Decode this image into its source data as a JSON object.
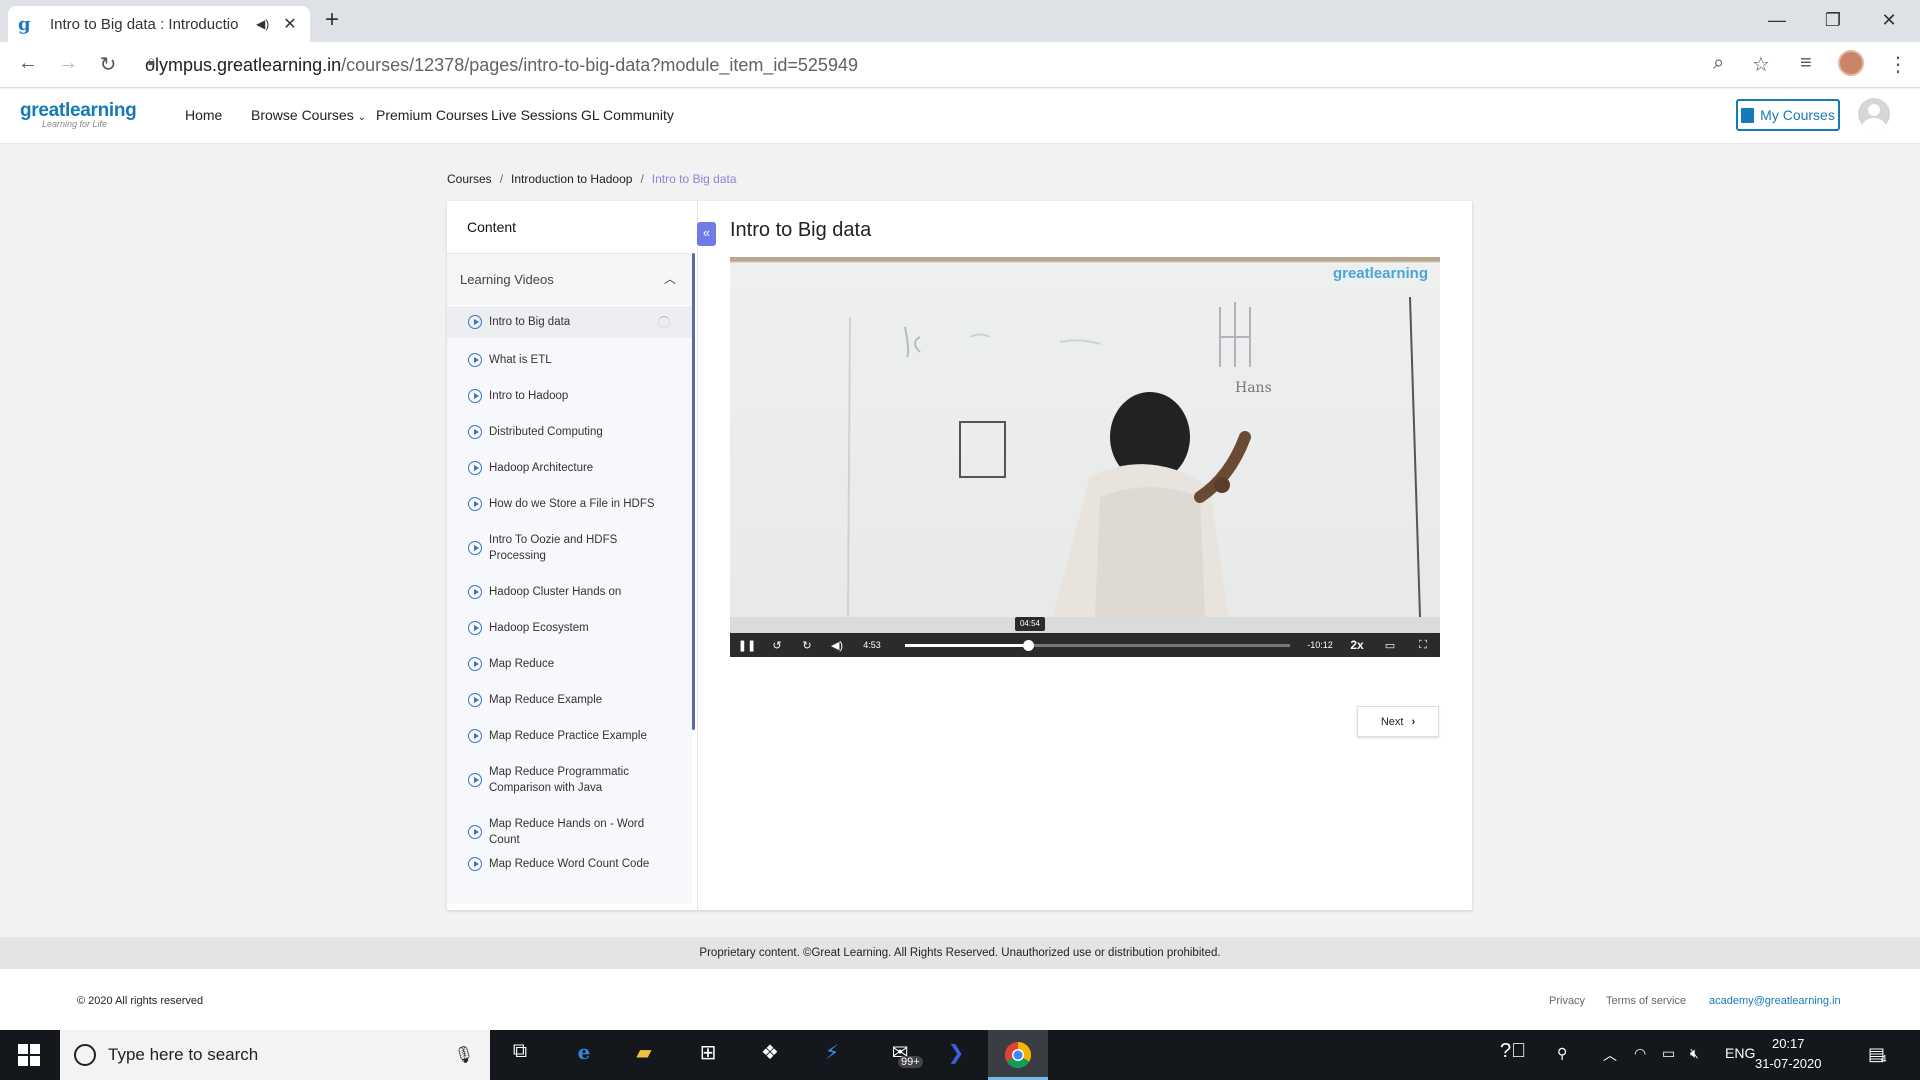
{
  "browser": {
    "tab_title": "Intro to Big data : Introductio",
    "url_host": "olympus.greatlearning.in",
    "url_path": "/courses/12378/pages/intro-to-big-data?module_item_id=525949"
  },
  "site": {
    "logo_text": "greatlearning",
    "logo_tagline": "Learning for Life",
    "nav": [
      "Home",
      "Browse Courses",
      "Premium Courses",
      "Live Sessions",
      "GL Community"
    ],
    "my_courses_label": "My Courses"
  },
  "breadcrumb": {
    "items": [
      "Courses",
      "Introduction to Hadoop",
      "Intro to Big data"
    ]
  },
  "sidebar": {
    "header": "Content",
    "section_title": "Learning Videos",
    "lessons": [
      "Intro to Big data",
      "What is ETL",
      "Intro to Hadoop",
      "Distributed Computing",
      "Hadoop Architecture",
      "How do we Store a File in HDFS",
      "Intro To Oozie and HDFS Processing",
      "Hadoop Cluster Hands on",
      "Hadoop Ecosystem",
      "Map Reduce",
      "Map Reduce Example",
      "Map Reduce Practice Example",
      "Map Reduce Programmatic Comparison with Java",
      "Map Reduce Hands on - Word Count",
      "Map Reduce Word Count Code"
    ],
    "active_index": 0
  },
  "content": {
    "title": "Intro to Big data",
    "video": {
      "watermark": "greatlearning",
      "current_time": "4:53",
      "remaining_time": "-10:12",
      "hover_time": "04:54",
      "speed": "2x",
      "progress": 0.32
    },
    "next_label": "Next"
  },
  "footer": {
    "notice": "Proprietary content. ©Great Learning. All Rights Reserved. Unauthorized use or distribution prohibited.",
    "copyright": "© 2020 All rights reserved",
    "links": [
      "Privacy",
      "Terms of service"
    ],
    "email": "academy@greatlearning.in"
  },
  "taskbar": {
    "search_placeholder": "Type here to search",
    "mail_badge": "99+",
    "language": "ENG",
    "time": "20:17",
    "date": "31-07-2020",
    "notification_count": "4"
  },
  "colors": {
    "brand": "#1679b8",
    "accent": "#6f7be6",
    "breadcrumb_current": "#8f83d8"
  }
}
